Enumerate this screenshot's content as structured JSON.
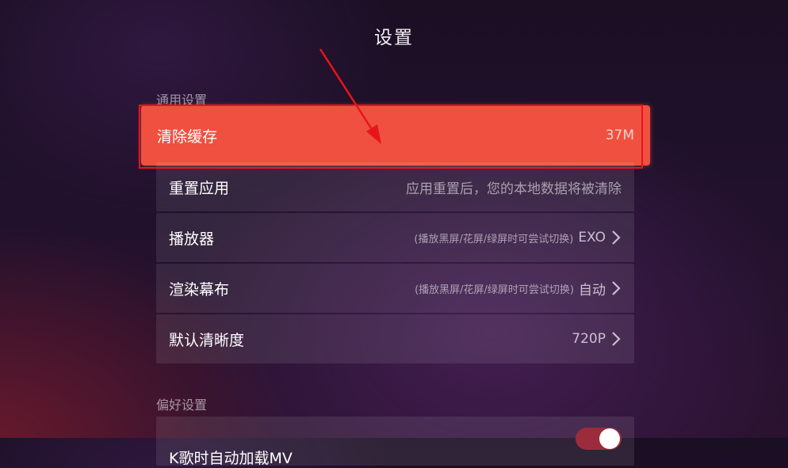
{
  "page": {
    "title": "设置"
  },
  "sections": {
    "general": "通用设置",
    "preferences": "偏好设置"
  },
  "rows": {
    "clear_cache": {
      "label": "清除缓存",
      "value": "37M"
    },
    "reset_app": {
      "label": "重置应用",
      "desc": "应用重置后，您的本地数据将被清除"
    },
    "player": {
      "label": "播放器",
      "hint": "(播放黑屏/花屏/绿屏时可尝试切换)",
      "value": "EXO"
    },
    "render_canvas": {
      "label": "渲染幕布",
      "hint": "(播放黑屏/花屏/绿屏时可尝试切换)",
      "value": "自动"
    },
    "default_quality": {
      "label": "默认清晰度",
      "value": "720P"
    },
    "auto_load_mv": {
      "label": "K歌时自动加载MV",
      "enabled": true
    }
  },
  "colors": {
    "accent": "#f0503f",
    "annotation_red": "#e8141c",
    "toggle_on": "#9c2b3c"
  },
  "icons": {
    "chevron": "chevron-right-icon",
    "annotation": "red-arrow-annotation"
  }
}
